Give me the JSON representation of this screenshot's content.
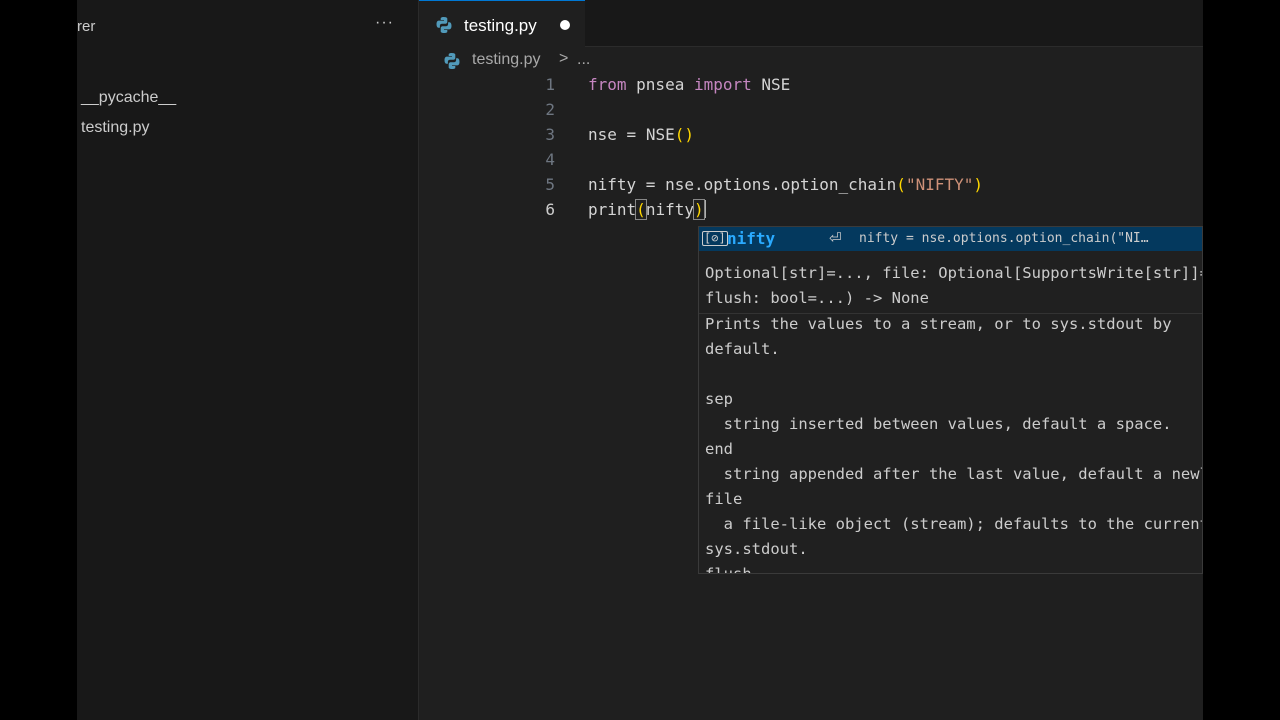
{
  "sidebar": {
    "title": "rer",
    "more_label": "···",
    "items": [
      {
        "label": "__pycache__"
      },
      {
        "label": "testing.py"
      }
    ]
  },
  "tab": {
    "label": "testing.py",
    "icon": "python-icon"
  },
  "breadcrumb": {
    "file": "testing.py",
    "separator": ">",
    "rest": "..."
  },
  "code": {
    "line_numbers": [
      "1",
      "2",
      "3",
      "4",
      "5",
      "6"
    ],
    "line1": {
      "kw1": "from",
      "mod": " pnsea ",
      "kw2": "import",
      "name": " NSE"
    },
    "line3": {
      "var": "nse",
      "eq": " = ",
      "cls": "NSE",
      "paren": "()"
    },
    "line5": {
      "var": "nifty",
      "eq": " = ",
      "obj": "nse",
      "dot1": ".",
      "attr": "options",
      "dot2": ".",
      "fn": "option_chain",
      "open": "(",
      "str": "\"NIFTY\"",
      "close": ")"
    },
    "line6": {
      "fn": "print",
      "open": "(",
      "arg": "nifty",
      "close": ")"
    }
  },
  "suggest": {
    "symbol_icon": "[⊘]",
    "name": "nifty",
    "enter_icon": "⏎",
    "detail": "nifty = nse.options.option_chain(\"NI…",
    "signature_line1": "Optional[str]=..., file: Optional[SupportsWrite[str]]=...,",
    "signature_line2": "flush: bool=...) -> None",
    "doc": "Prints the values to a stream, or to sys.stdout by\ndefault.\n\nsep\n  string inserted between values, default a space.\nend\n  string appended after the last value, default a newline.\nfile\n  a file-like object (stream); defaults to the current\nsys.stdout.\nflush"
  },
  "colors": {
    "accent": "#0078d4",
    "suggest_selected": "#04395e",
    "editor_bg": "#1f1f1f"
  }
}
